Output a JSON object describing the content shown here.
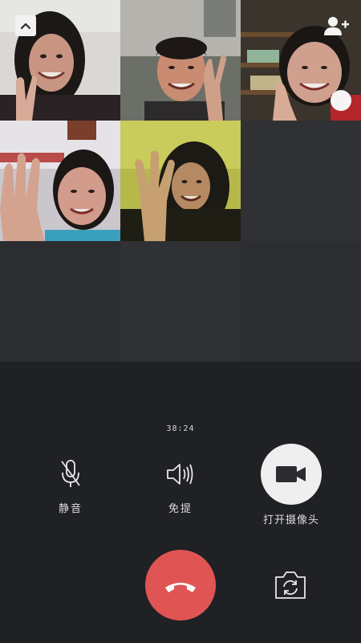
{
  "call": {
    "timer": "38:24"
  },
  "participants": [
    {
      "tile": "participant-1",
      "gesture": "peace-sign"
    },
    {
      "tile": "participant-2",
      "gesture": "peace-sign"
    },
    {
      "tile": "participant-3",
      "gesture": "thumbs-up",
      "badge": "signal-icon"
    },
    {
      "tile": "participant-4",
      "gesture": "wave"
    },
    {
      "tile": "participant-5",
      "gesture": "wave"
    }
  ],
  "controls": {
    "mute_label": "静音",
    "speaker_label": "免提",
    "camera_label": "打开摄像头"
  },
  "icons": {
    "collapse": "chevron-up-icon",
    "add_member": "add-person-icon",
    "mute": "microphone-icon",
    "speaker": "speaker-icon",
    "camera": "video-camera-icon",
    "hangup": "phone-hangup-icon",
    "flip": "camera-flip-icon"
  },
  "colors": {
    "background": "#1f2124",
    "hangup": "#e15454",
    "camera_button": "#efefef",
    "signal_badge": "#3aa64a"
  }
}
